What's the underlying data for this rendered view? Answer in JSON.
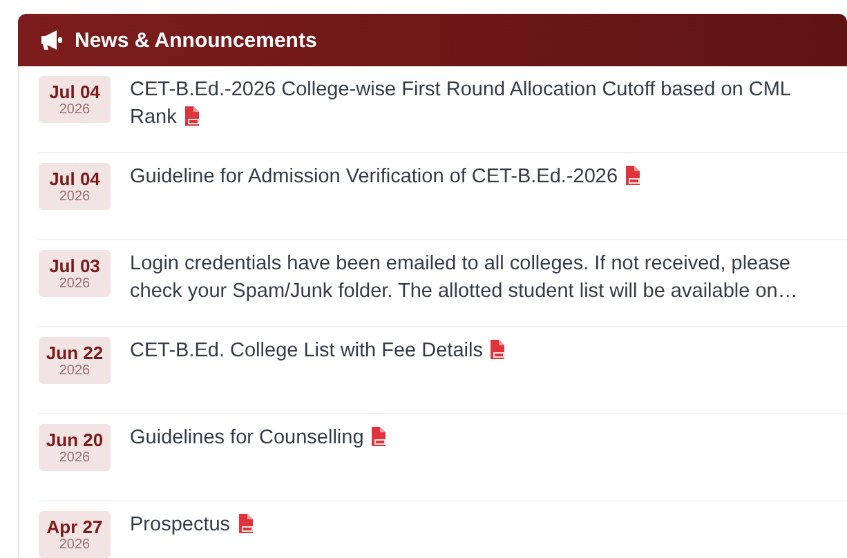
{
  "panel": {
    "title": "News & Announcements"
  },
  "items": [
    {
      "month_day": "Jul 04",
      "year": "2026",
      "text": "CET-B.Ed.-2026 College-wise First Round Allocation Cutoff based on CML Rank",
      "pdf": true
    },
    {
      "month_day": "Jul 04",
      "year": "2026",
      "text": "Guideline for Admission Verification of CET-B.Ed.-2026",
      "pdf": true
    },
    {
      "month_day": "Jul 03",
      "year": "2026",
      "text": "Login credentials have been emailed to all colleges. If not received, please check your Spam/Junk folder. The allotted student list will be available on…",
      "pdf": false
    },
    {
      "month_day": "Jun 22",
      "year": "2026",
      "text": "CET-B.Ed. College List with Fee Details",
      "pdf": true
    },
    {
      "month_day": "Jun 20",
      "year": "2026",
      "text": "Guidelines for Counselling",
      "pdf": true
    },
    {
      "month_day": "Apr 27",
      "year": "2026",
      "text": "Prospectus",
      "pdf": true
    }
  ]
}
